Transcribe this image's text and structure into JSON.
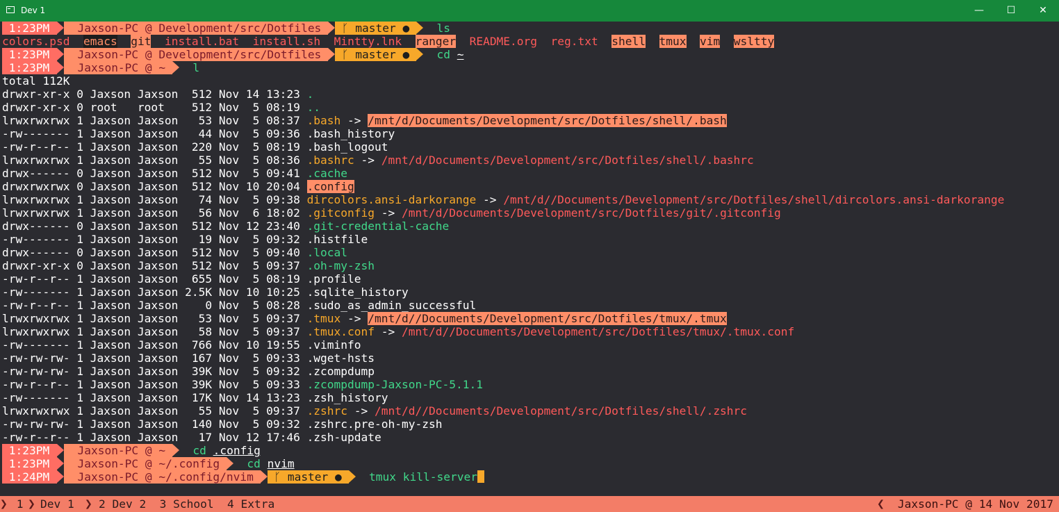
{
  "window": {
    "title": "Dev 1",
    "minimize": "—",
    "maximize": "☐",
    "close": "✕",
    "colors": {
      "titlebar": "#16883b",
      "background": "#2b2b30",
      "accent": "#ff6d63"
    }
  },
  "prompts": [
    {
      "time": "1:23PM",
      "host": "Jaxson-PC @ Development/src/Dotfiles",
      "git": "master ●",
      "cmd": "ls",
      "arg": ""
    },
    {
      "time": "1:23PM",
      "host": "Jaxson-PC @ Development/src/Dotfiles",
      "git": "master ●",
      "cmd": "cd",
      "arg": "~"
    },
    {
      "time": "1:23PM",
      "host": "Jaxson-PC @ ~",
      "git": "",
      "cmd": "l",
      "arg": ""
    },
    {
      "time": "1:23PM",
      "host": "Jaxson-PC @ ~",
      "git": "",
      "cmd": "cd",
      "arg": ".config"
    },
    {
      "time": "1:23PM",
      "host": "Jaxson-PC @ ~/.config",
      "git": "",
      "cmd": "cd",
      "arg": "nvim"
    },
    {
      "time": "1:24PM",
      "host": "Jaxson-PC @ ~/.config/nvim",
      "git": "master ●",
      "cmd": "tmux kill-server",
      "arg": ""
    }
  ],
  "ls_output": [
    "colors.psd",
    "emacs",
    "git",
    "install.bat",
    "install.sh",
    "Mintty.lnk",
    "ranger",
    "README.org",
    "reg.txt",
    "shell",
    "tmux",
    "vim",
    "wsltty"
  ],
  "total": "total 112K",
  "listing": [
    {
      "perm": "drwxr-xr-x",
      "links": "0",
      "user": "Jaxson",
      "group": "Jaxson",
      "size": "512",
      "date": "Nov 14 13:23",
      "name": ".",
      "target": "",
      "kind": "dir"
    },
    {
      "perm": "drwxr-xr-x",
      "links": "0",
      "user": "root",
      "group": "root",
      "size": "512",
      "date": "Nov  5 08:19",
      "name": "..",
      "target": "",
      "kind": "dir"
    },
    {
      "perm": "lrwxrwxrwx",
      "links": "1",
      "user": "Jaxson",
      "group": "Jaxson",
      "size": "53",
      "date": "Nov  5 08:37",
      "name": ".bash",
      "target": "/mnt/d/Documents/Development/src/Dotfiles/shell/.bash",
      "kind": "link-dir"
    },
    {
      "perm": "-rw-------",
      "links": "1",
      "user": "Jaxson",
      "group": "Jaxson",
      "size": "44",
      "date": "Nov  5 09:36",
      "name": ".bash_history",
      "target": "",
      "kind": "file"
    },
    {
      "perm": "-rw-r--r--",
      "links": "1",
      "user": "Jaxson",
      "group": "Jaxson",
      "size": "220",
      "date": "Nov  5 08:19",
      "name": ".bash_logout",
      "target": "",
      "kind": "file"
    },
    {
      "perm": "lrwxrwxrwx",
      "links": "1",
      "user": "Jaxson",
      "group": "Jaxson",
      "size": "55",
      "date": "Nov  5 08:36",
      "name": ".bashrc",
      "target": "/mnt/d/Documents/Development/src/Dotfiles/shell/.bashrc",
      "kind": "link-file"
    },
    {
      "perm": "drwx------",
      "links": "0",
      "user": "Jaxson",
      "group": "Jaxson",
      "size": "512",
      "date": "Nov  5 09:41",
      "name": ".cache",
      "target": "",
      "kind": "dir"
    },
    {
      "perm": "drwxrwxrwx",
      "links": "0",
      "user": "Jaxson",
      "group": "Jaxson",
      "size": "512",
      "date": "Nov 10 20:04",
      "name": ".config",
      "target": "",
      "kind": "dir-hl"
    },
    {
      "perm": "lrwxrwxrwx",
      "links": "1",
      "user": "Jaxson",
      "group": "Jaxson",
      "size": "74",
      "date": "Nov  5 09:38",
      "name": "dircolors.ansi-darkorange",
      "target": "/mnt/d//Documents/Development/src/Dotfiles/shell/dircolors.ansi-darkorange",
      "kind": "link-file"
    },
    {
      "perm": "lrwxrwxrwx",
      "links": "1",
      "user": "Jaxson",
      "group": "Jaxson",
      "size": "56",
      "date": "Nov  6 18:02",
      "name": ".gitconfig",
      "target": "/mnt/d/Documents/Development/src/Dotfiles/git/.gitconfig",
      "kind": "link-file"
    },
    {
      "perm": "drwx------",
      "links": "0",
      "user": "Jaxson",
      "group": "Jaxson",
      "size": "512",
      "date": "Nov 12 23:40",
      "name": ".git-credential-cache",
      "target": "",
      "kind": "dir"
    },
    {
      "perm": "-rw-------",
      "links": "1",
      "user": "Jaxson",
      "group": "Jaxson",
      "size": "19",
      "date": "Nov  5 09:32",
      "name": ".histfile",
      "target": "",
      "kind": "file"
    },
    {
      "perm": "drwx------",
      "links": "0",
      "user": "Jaxson",
      "group": "Jaxson",
      "size": "512",
      "date": "Nov  5 09:40",
      "name": ".local",
      "target": "",
      "kind": "dir"
    },
    {
      "perm": "drwxr-xr-x",
      "links": "0",
      "user": "Jaxson",
      "group": "Jaxson",
      "size": "512",
      "date": "Nov  5 09:37",
      "name": ".oh-my-zsh",
      "target": "",
      "kind": "dir"
    },
    {
      "perm": "-rw-r--r--",
      "links": "1",
      "user": "Jaxson",
      "group": "Jaxson",
      "size": "655",
      "date": "Nov  5 08:19",
      "name": ".profile",
      "target": "",
      "kind": "file"
    },
    {
      "perm": "-rw-------",
      "links": "1",
      "user": "Jaxson",
      "group": "Jaxson",
      "size": "2.5K",
      "date": "Nov 10 10:25",
      "name": ".sqlite_history",
      "target": "",
      "kind": "file"
    },
    {
      "perm": "-rw-r--r--",
      "links": "1",
      "user": "Jaxson",
      "group": "Jaxson",
      "size": "0",
      "date": "Nov  5 08:28",
      "name": ".sudo_as_admin_successful",
      "target": "",
      "kind": "file"
    },
    {
      "perm": "lrwxrwxrwx",
      "links": "1",
      "user": "Jaxson",
      "group": "Jaxson",
      "size": "53",
      "date": "Nov  5 09:37",
      "name": ".tmux",
      "target": "/mnt/d//Documents/Development/src/Dotfiles/tmux/.tmux",
      "kind": "link-dir"
    },
    {
      "perm": "lrwxrwxrwx",
      "links": "1",
      "user": "Jaxson",
      "group": "Jaxson",
      "size": "58",
      "date": "Nov  5 09:37",
      "name": ".tmux.conf",
      "target": "/mnt/d//Documents/Development/src/Dotfiles/tmux/.tmux.conf",
      "kind": "link-file"
    },
    {
      "perm": "-rw-------",
      "links": "1",
      "user": "Jaxson",
      "group": "Jaxson",
      "size": "766",
      "date": "Nov 10 19:55",
      "name": ".viminfo",
      "target": "",
      "kind": "file"
    },
    {
      "perm": "-rw-rw-rw-",
      "links": "1",
      "user": "Jaxson",
      "group": "Jaxson",
      "size": "167",
      "date": "Nov  5 09:33",
      "name": ".wget-hsts",
      "target": "",
      "kind": "file"
    },
    {
      "perm": "-rw-rw-rw-",
      "links": "1",
      "user": "Jaxson",
      "group": "Jaxson",
      "size": "39K",
      "date": "Nov  5 09:32",
      "name": ".zcompdump",
      "target": "",
      "kind": "file"
    },
    {
      "perm": "-rw-r--r--",
      "links": "1",
      "user": "Jaxson",
      "group": "Jaxson",
      "size": "39K",
      "date": "Nov  5 09:33",
      "name": ".zcompdump-Jaxson-PC-5.1.1",
      "target": "",
      "kind": "dir"
    },
    {
      "perm": "-rw-------",
      "links": "1",
      "user": "Jaxson",
      "group": "Jaxson",
      "size": "17K",
      "date": "Nov 14 13:23",
      "name": ".zsh_history",
      "target": "",
      "kind": "file"
    },
    {
      "perm": "lrwxrwxrwx",
      "links": "1",
      "user": "Jaxson",
      "group": "Jaxson",
      "size": "55",
      "date": "Nov  5 09:37",
      "name": ".zshrc",
      "target": "/mnt/d//Documents/Development/src/Dotfiles/shell/.zshrc",
      "kind": "link-file"
    },
    {
      "perm": "-rw-rw-rw-",
      "links": "1",
      "user": "Jaxson",
      "group": "Jaxson",
      "size": "140",
      "date": "Nov  5 09:32",
      "name": ".zshrc.pre-oh-my-zsh",
      "target": "",
      "kind": "file"
    },
    {
      "perm": "-rw-r--r--",
      "links": "1",
      "user": "Jaxson",
      "group": "Jaxson",
      "size": "17",
      "date": "Nov 12 17:46",
      "name": ".zsh-update",
      "target": "",
      "kind": "file"
    }
  ],
  "arrow": "->",
  "git_branch_icon": "ᚴ",
  "status": {
    "tabs": [
      {
        "index": "1",
        "name": "Dev 1",
        "active": true
      },
      {
        "index": "2",
        "name": "Dev 2",
        "active": false
      },
      {
        "index": "3",
        "name": "School",
        "active": false
      },
      {
        "index": "4",
        "name": "Extra",
        "active": false
      }
    ],
    "right": "Jaxson-PC @ 14 Nov 2017"
  }
}
